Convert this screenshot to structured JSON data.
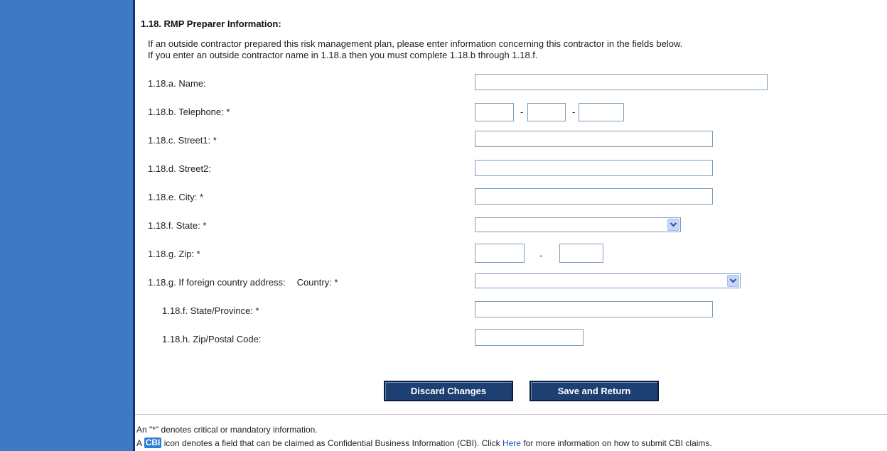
{
  "section": {
    "title": "1.18. RMP Preparer Information:",
    "intro_line1": "If an outside contractor prepared this risk management plan, please enter information concerning this contractor in the fields below.",
    "intro_line2": "If you enter an outside contractor name in 1.18.a then you must complete 1.18.b through 1.18.f."
  },
  "form": {
    "name_label": "1.18.a. Name:",
    "telephone_label": "1.18.b. Telephone: *",
    "phone_separator": "-",
    "street1_label": "1.18.c. Street1: *",
    "street2_label": "1.18.d. Street2:",
    "city_label": "1.18.e. City: *",
    "state_label": "1.18.f. State: *",
    "zip_label": "1.18.g. Zip: *",
    "zip_separator": "-",
    "foreign_label": "1.18.g. If foreign country address:",
    "country_label": "Country: *",
    "province_label": "1.18.f. State/Province: *",
    "postal_label": "1.18.h. Zip/Postal Code:",
    "values": {
      "name": "",
      "phone_area": "",
      "phone_prefix": "",
      "phone_line": "",
      "street1": "",
      "street2": "",
      "city": "",
      "state": "",
      "zip": "",
      "zip_ext": "",
      "country": "",
      "province": "",
      "postal": ""
    }
  },
  "buttons": {
    "discard": "Discard Changes",
    "save": "Save and Return"
  },
  "footer": {
    "mandatory_note": "An \"*\" denotes critical or mandatory information.",
    "cbi_prefix": "A",
    "cbi_icon_text": "CBI",
    "cbi_text": "icon denotes a field that can be claimed as Confidential Business Information (CBI). Click",
    "cbi_link": "Here",
    "cbi_suffix": "for more information on how to submit CBI claims."
  },
  "colors": {
    "sidebar": "#3e79c5",
    "button": "#1e3f72",
    "link": "#1a4fc2",
    "cbi_icon": "#2e7fd0"
  },
  "icons": {
    "dropdown": "chevron-down-icon",
    "cbi": "cbi-icon"
  }
}
